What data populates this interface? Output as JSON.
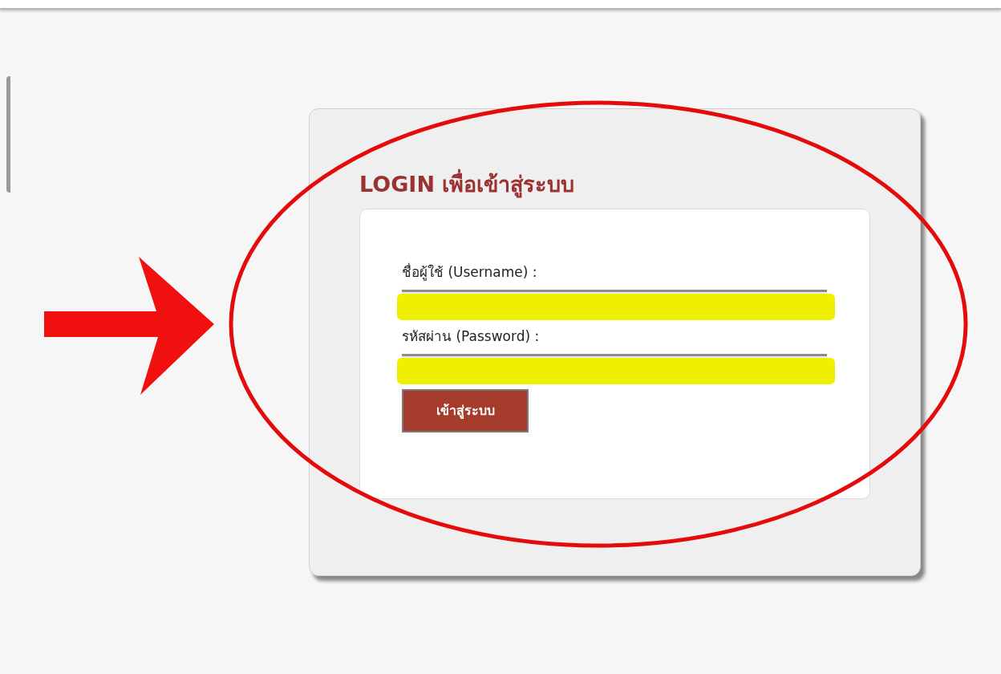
{
  "login_card": {
    "title": "LOGIN เพื่อเข้าสู่ระบบ",
    "fields": [
      {
        "label": "ชื่อผู้ใช้ (Username) :"
      },
      {
        "label": "รหัสผ่าน (Password) :"
      }
    ],
    "submit_button": "เข้าสู่ระบบ"
  }
}
